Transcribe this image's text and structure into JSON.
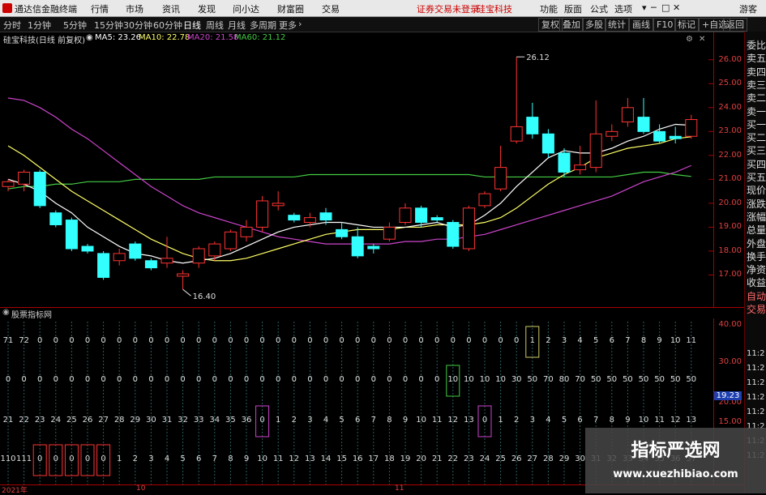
{
  "topbar": {
    "app_title": "通达信金融终端",
    "menus": [
      "行情",
      "市场",
      "资讯",
      "发现",
      "问小达",
      "财富圈",
      "交易"
    ],
    "notice": "证券交易未登录",
    "stock_name": "硅宝科技",
    "right_menus": [
      "功能",
      "版面",
      "公式",
      "选项"
    ],
    "guest": "游客"
  },
  "periodbar": {
    "periods": [
      "分时",
      "1分钟",
      "5分钟",
      "15分钟",
      "30分钟",
      "60分钟",
      "日线",
      "周线",
      "月线",
      "多周期",
      "更多"
    ],
    "active_period": "日线",
    "right_buttons": [
      "复权",
      "叠加",
      "多股",
      "统计",
      "画线",
      "F10",
      "标记",
      "+自选",
      "返回"
    ]
  },
  "main_legend": {
    "stock": "硅宝科技(日线 前复权)",
    "ma5": "MA5: 23.26",
    "ma10": "MA10: 22.78",
    "ma20": "MA20: 21.58",
    "ma60": "MA60: 21.12",
    "colors": {
      "ma5": "#ffffff",
      "ma10": "#ffff66",
      "ma20": "#cc44cc",
      "ma60": "#44cc44",
      "up": "#ff3333",
      "down": "#33ffff"
    }
  },
  "annotations": {
    "high": "26.12",
    "low": "16.40"
  },
  "price_axis": [
    "26.00",
    "25.00",
    "24.00",
    "23.00",
    "22.00",
    "21.00",
    "20.00",
    "19.00",
    "18.00",
    "17.00"
  ],
  "sub_panel": {
    "title": "股票指标网",
    "axis": [
      "40.00",
      "30.00",
      "20.00",
      "15.00"
    ],
    "axis_highlight": "19.23"
  },
  "side_panel": {
    "labels": [
      "委比",
      "卖五",
      "卖四",
      "卖三",
      "卖二",
      "卖一",
      "买一",
      "买二",
      "买三",
      "买四",
      "买五",
      "现价",
      "涨跌",
      "涨幅",
      "总量",
      "外盘",
      "换手",
      "净资",
      "收益",
      "自动",
      "交易"
    ],
    "times": [
      "11:2",
      "11:2",
      "11:2",
      "11:2",
      "11:2",
      "11:2",
      "11:2",
      "11:2"
    ]
  },
  "indicator_rows": [
    [
      "71",
      "72",
      "0",
      "0",
      "0",
      "0",
      "0",
      "0",
      "0",
      "0",
      "0",
      "0",
      "0",
      "0",
      "0",
      "0",
      "0",
      "0",
      "0",
      "0",
      "0",
      "0",
      "0",
      "0",
      "0",
      "0",
      "0",
      "0",
      "0",
      "0",
      "0",
      "0",
      "0",
      "1",
      "2",
      "3",
      "4",
      "5",
      "6",
      "7",
      "8",
      "9",
      "10",
      "11"
    ],
    [
      "0",
      "0",
      "0",
      "0",
      "0",
      "0",
      "0",
      "0",
      "0",
      "0",
      "0",
      "0",
      "0",
      "0",
      "0",
      "0",
      "0",
      "0",
      "0",
      "0",
      "0",
      "0",
      "0",
      "0",
      "0",
      "0",
      "0",
      "0",
      "10",
      "10",
      "10",
      "10",
      "30",
      "50",
      "70",
      "80",
      "70",
      "50",
      "50",
      "50",
      "50",
      "50",
      "50",
      "50"
    ],
    [
      "21",
      "22",
      "23",
      "24",
      "25",
      "26",
      "27",
      "28",
      "29",
      "30",
      "31",
      "32",
      "33",
      "34",
      "35",
      "36",
      "0",
      "1",
      "2",
      "3",
      "4",
      "5",
      "6",
      "7",
      "8",
      "9",
      "10",
      "11",
      "12",
      "13",
      "0",
      "1",
      "2",
      "3",
      "4",
      "5",
      "6",
      "7",
      "8",
      "9",
      "10",
      "11",
      "12",
      "13"
    ],
    [
      "110",
      "111",
      "0",
      "0",
      "0",
      "0",
      "0",
      "1",
      "2",
      "3",
      "4",
      "5",
      "6",
      "7",
      "8",
      "9",
      "10",
      "11",
      "12",
      "13",
      "14",
      "15",
      "16",
      "17",
      "18",
      "19",
      "20",
      "21",
      "22",
      "23",
      "24",
      "25",
      "26",
      "27",
      "28",
      "29",
      "30",
      "31",
      "32",
      "33",
      "34",
      "35",
      "36",
      "37"
    ]
  ],
  "dates": [
    "2021年",
    "10",
    "11"
  ],
  "watermark": {
    "line1": "指标严选网",
    "line2": "www.xuezhibiao.com"
  },
  "chart_data": {
    "type": "candlestick",
    "ylim": [
      16.0,
      26.5
    ],
    "candles": [
      [
        20.7,
        20.9,
        20.5,
        21.0
      ],
      [
        20.8,
        21.3,
        20.5,
        21.4
      ],
      [
        21.3,
        19.9,
        19.8,
        21.4
      ],
      [
        19.6,
        19.1,
        19.0,
        19.7
      ],
      [
        19.3,
        18.1,
        18.0,
        19.4
      ],
      [
        18.2,
        18.0,
        17.9,
        18.3
      ],
      [
        17.9,
        16.9,
        16.8,
        18.0
      ],
      [
        17.6,
        17.9,
        17.4,
        18.1
      ],
      [
        18.3,
        17.7,
        17.6,
        18.4
      ],
      [
        17.6,
        17.3,
        17.2,
        17.7
      ],
      [
        17.5,
        17.7,
        17.3,
        18.6
      ],
      [
        16.95,
        17.05,
        16.4,
        17.2
      ],
      [
        17.5,
        18.1,
        17.3,
        18.2
      ],
      [
        17.8,
        18.3,
        17.6,
        18.4
      ],
      [
        18.1,
        18.8,
        18.0,
        18.9
      ],
      [
        18.6,
        19.0,
        18.4,
        19.3
      ],
      [
        19.0,
        20.1,
        18.8,
        20.3
      ],
      [
        19.9,
        20.0,
        19.7,
        20.5
      ],
      [
        19.5,
        19.3,
        19.2,
        19.6
      ],
      [
        19.2,
        19.4,
        19.0,
        19.6
      ],
      [
        19.6,
        19.3,
        19.1,
        19.8
      ],
      [
        18.9,
        18.6,
        18.5,
        19.2
      ],
      [
        18.6,
        17.8,
        17.7,
        19.0
      ],
      [
        18.2,
        18.1,
        17.9,
        18.3
      ],
      [
        18.5,
        19.0,
        18.4,
        19.2
      ],
      [
        19.2,
        19.8,
        19.1,
        20.0
      ],
      [
        19.8,
        19.2,
        19.0,
        19.9
      ],
      [
        19.4,
        19.3,
        19.2,
        19.5
      ],
      [
        19.2,
        18.2,
        18.1,
        19.3
      ],
      [
        18.1,
        19.8,
        18.0,
        19.9
      ],
      [
        19.9,
        20.4,
        19.8,
        20.5
      ],
      [
        20.6,
        21.5,
        20.5,
        22.4
      ],
      [
        22.6,
        23.2,
        22.5,
        26.12
      ],
      [
        23.6,
        22.9,
        22.7,
        24.2
      ],
      [
        22.9,
        22.1,
        21.9,
        23.1
      ],
      [
        22.1,
        21.3,
        21.1,
        22.3
      ],
      [
        21.4,
        21.6,
        21.2,
        22.4
      ],
      [
        21.5,
        22.9,
        21.3,
        24.3
      ],
      [
        22.8,
        23.0,
        22.6,
        23.3
      ],
      [
        23.4,
        24.0,
        23.2,
        24.4
      ],
      [
        23.6,
        23.0,
        22.9,
        24.4
      ],
      [
        23.0,
        22.6,
        22.5,
        23.3
      ],
      [
        22.8,
        22.7,
        22.5,
        23.2
      ],
      [
        22.8,
        23.5,
        22.7,
        23.7
      ]
    ],
    "ma5": [
      21.0,
      20.8,
      20.5,
      20.0,
      19.6,
      19.0,
      18.6,
      18.2,
      17.9,
      17.8,
      17.6,
      17.5,
      17.6,
      17.7,
      17.9,
      18.2,
      18.5,
      18.8,
      19.0,
      19.1,
      19.2,
      19.2,
      19.1,
      19.0,
      19.0,
      19.0,
      19.1,
      19.2,
      19.0,
      19.1,
      19.5,
      20.0,
      20.7,
      21.3,
      21.9,
      22.2,
      22.1,
      22.1,
      22.3,
      22.6,
      22.8,
      23.1,
      23.3,
      23.26
    ],
    "ma10": [
      22.4,
      22.0,
      21.5,
      21.0,
      20.5,
      20.1,
      19.7,
      19.3,
      18.9,
      18.5,
      18.2,
      17.9,
      17.7,
      17.6,
      17.6,
      17.7,
      17.9,
      18.1,
      18.3,
      18.5,
      18.7,
      18.8,
      18.9,
      18.9,
      18.9,
      19.0,
      19.0,
      19.1,
      19.1,
      19.1,
      19.2,
      19.4,
      19.8,
      20.3,
      20.8,
      21.2,
      21.5,
      21.9,
      22.1,
      22.3,
      22.4,
      22.5,
      22.7,
      22.78
    ],
    "ma20": [
      24.4,
      24.3,
      24.0,
      23.6,
      23.1,
      22.7,
      22.2,
      21.7,
      21.2,
      20.7,
      20.3,
      19.9,
      19.6,
      19.4,
      19.2,
      19.0,
      18.8,
      18.6,
      18.5,
      18.4,
      18.3,
      18.3,
      18.3,
      18.3,
      18.3,
      18.4,
      18.4,
      18.5,
      18.5,
      18.6,
      18.7,
      18.9,
      19.1,
      19.3,
      19.5,
      19.7,
      19.9,
      20.1,
      20.3,
      20.6,
      20.9,
      21.1,
      21.3,
      21.58
    ],
    "ma60": [
      20.6,
      20.7,
      20.7,
      20.8,
      20.8,
      20.9,
      20.9,
      20.9,
      21.0,
      21.0,
      21.0,
      21.0,
      21.0,
      21.1,
      21.1,
      21.1,
      21.1,
      21.1,
      21.1,
      21.2,
      21.2,
      21.2,
      21.2,
      21.2,
      21.2,
      21.2,
      21.2,
      21.2,
      21.2,
      21.2,
      21.1,
      21.1,
      21.1,
      21.1,
      21.1,
      21.1,
      21.1,
      21.1,
      21.1,
      21.2,
      21.3,
      21.3,
      21.2,
      21.12
    ]
  }
}
